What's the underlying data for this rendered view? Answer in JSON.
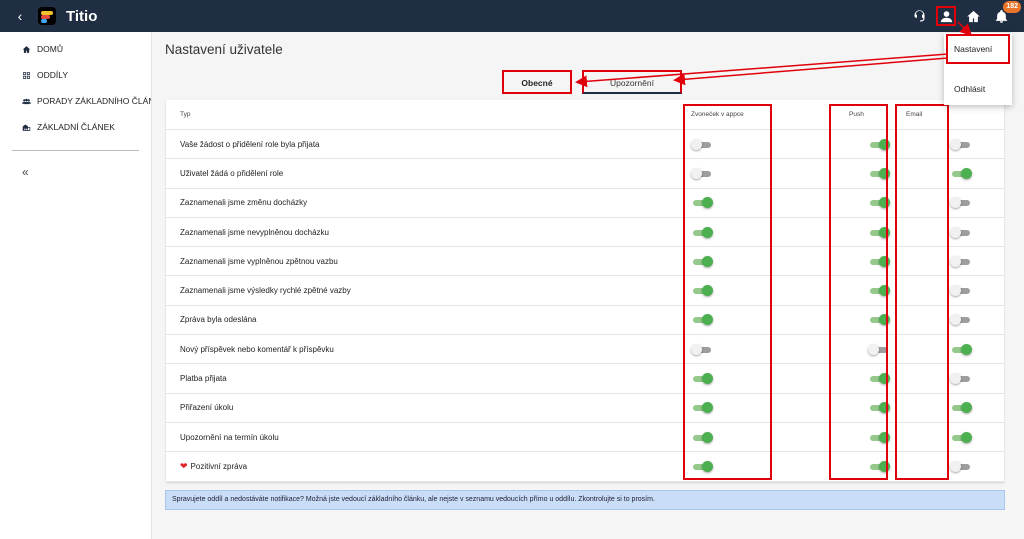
{
  "app": {
    "title": "Titio",
    "notification_count": "182"
  },
  "topbar": {
    "icons": [
      "chevron-left-icon",
      "support-icon",
      "user-icon",
      "home-icon",
      "bell-icon"
    ]
  },
  "sidebar": {
    "items": [
      {
        "label": "DOMŮ",
        "icon": "home-icon"
      },
      {
        "label": "ODDÍLY",
        "icon": "grid-icon"
      },
      {
        "label": "PORADY ZÁKLADNÍHO ČLÁNKU",
        "icon": "group-icon"
      },
      {
        "label": "ZÁKLADNÍ ČLÁNEK",
        "icon": "building-icon"
      }
    ],
    "collapse_label": "«"
  },
  "main": {
    "title": "Nastavení uživatele",
    "tabs": [
      {
        "label": "Obecné"
      },
      {
        "label": "Upozornění"
      }
    ],
    "table": {
      "headers": {
        "type": "Typ",
        "bell": "Zvoneček v appce",
        "push": "Push",
        "email": "Email"
      },
      "rows": [
        {
          "label": "Vaše žádost o přidělení role byla přijata",
          "bell": false,
          "push": true,
          "email": false
        },
        {
          "label": "Uživatel žádá o přidělení role",
          "bell": false,
          "push": true,
          "email": true
        },
        {
          "label": "Zaznamenali jsme změnu docházky",
          "bell": true,
          "push": true,
          "email": false
        },
        {
          "label": "Zaznamenali jsme nevyplněnou docházku",
          "bell": true,
          "push": true,
          "email": false
        },
        {
          "label": "Zaznamenali jsme vyplněnou zpětnou vazbu",
          "bell": true,
          "push": true,
          "email": false
        },
        {
          "label": "Zaznamenali jsme výsledky rychlé zpětné vazby",
          "bell": true,
          "push": true,
          "email": false
        },
        {
          "label": "Zpráva byla odeslána",
          "bell": true,
          "push": true,
          "email": false
        },
        {
          "label": "Nový příspěvek nebo komentář k příspěvku",
          "bell": false,
          "push": false,
          "email": true
        },
        {
          "label": "Platba přijata",
          "bell": true,
          "push": true,
          "email": false
        },
        {
          "label": "Přiřazení úkolu",
          "bell": true,
          "push": true,
          "email": true
        },
        {
          "label": "Upozornění na termín úkolu",
          "bell": true,
          "push": true,
          "email": true
        },
        {
          "label": "Pozitivní zpráva",
          "bell": true,
          "push": true,
          "email": false,
          "prefix_icon": "heart-icon"
        }
      ]
    },
    "info_message": "Spravujete oddíl a nedostáváte notifikace? Možná jste vedoucí základního článku, ale nejste v seznamu vedoucích přímo u oddílu. Zkontrolujte si to prosím."
  },
  "user_menu": {
    "items": [
      {
        "label": "Nastavení"
      },
      {
        "label": "Odhlásit"
      }
    ]
  },
  "colors": {
    "topbar": "#1f2e42",
    "toggle_on": "#4caf50",
    "toggle_off": "#9e9e9e",
    "annotation": "#e0000b",
    "info_bg": "#c9ddf7",
    "badge": "#e8752a"
  }
}
